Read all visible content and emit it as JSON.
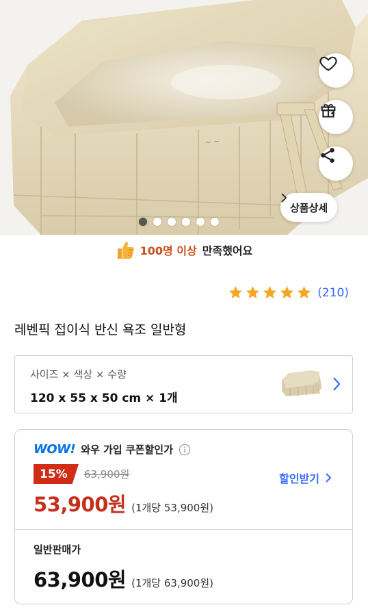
{
  "hero": {
    "detail_button_label": "상품상세",
    "carousel_count": 6,
    "carousel_active_index": 0
  },
  "satisfaction": {
    "highlight": "100명 이상",
    "rest": "만족했어요"
  },
  "rating": {
    "stars": 5,
    "count": "(210)",
    "star_color": "#f5a623"
  },
  "product": {
    "title": "레벤픽 접이식 반신 욕조 일반형"
  },
  "option": {
    "label": "사이즈 × 색상 × 수량",
    "value": "120 x 55 x 50 cm × 1개"
  },
  "price": {
    "wow_logo": "WOW!",
    "wow_label": "와우 가입 쿠폰할인가",
    "discount_badge": "15%",
    "original_price": "63,900원",
    "coupon_link": "할인받기",
    "sale_price": "53,900원",
    "sale_unit_price": "(1개당 53,900원)",
    "normal_label": "일반판매가",
    "normal_price": "63,900원",
    "normal_unit_price": "(1개당 63,900원)"
  },
  "colors": {
    "accent_blue": "#346aff",
    "sale_red": "#c5301d",
    "badge_red": "#d12d16",
    "wow_blue": "#0073e9"
  }
}
